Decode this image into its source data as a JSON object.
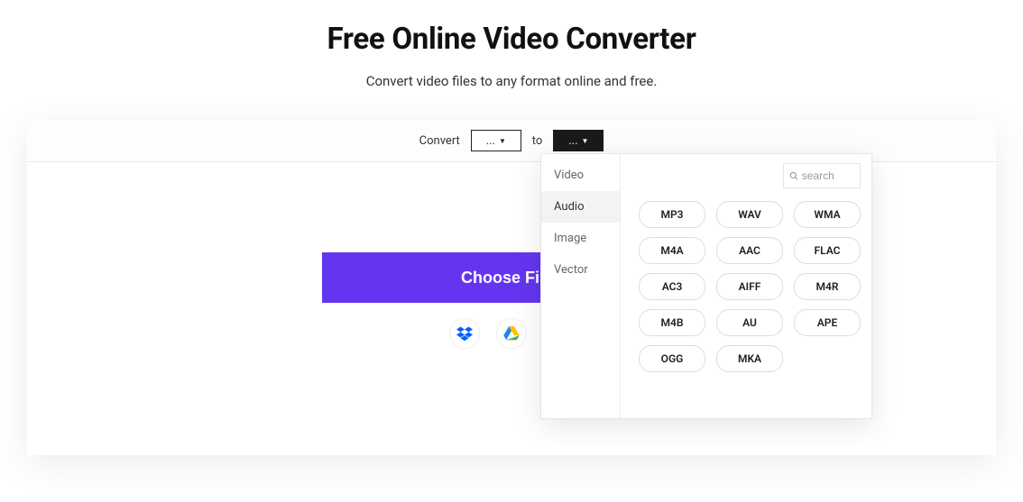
{
  "title": "Free Online Video Converter",
  "subtitle": "Convert video files to any format online and free.",
  "toolbar": {
    "convert_label": "Convert",
    "from_value": "...",
    "to_label": "to",
    "to_value": "..."
  },
  "choose_button_label": "Choose Files",
  "cloud": {
    "dropbox": "dropbox-icon",
    "drive": "google-drive-icon",
    "other": "red-service-icon"
  },
  "dropdown": {
    "categories": [
      {
        "label": "Video",
        "active": false
      },
      {
        "label": "Audio",
        "active": true
      },
      {
        "label": "Image",
        "active": false
      },
      {
        "label": "Vector",
        "active": false
      }
    ],
    "search_placeholder": "search",
    "formats": [
      "MP3",
      "WAV",
      "WMA",
      "M4A",
      "AAC",
      "FLAC",
      "AC3",
      "AIFF",
      "M4R",
      "M4B",
      "AU",
      "APE",
      "OGG",
      "MKA"
    ]
  }
}
